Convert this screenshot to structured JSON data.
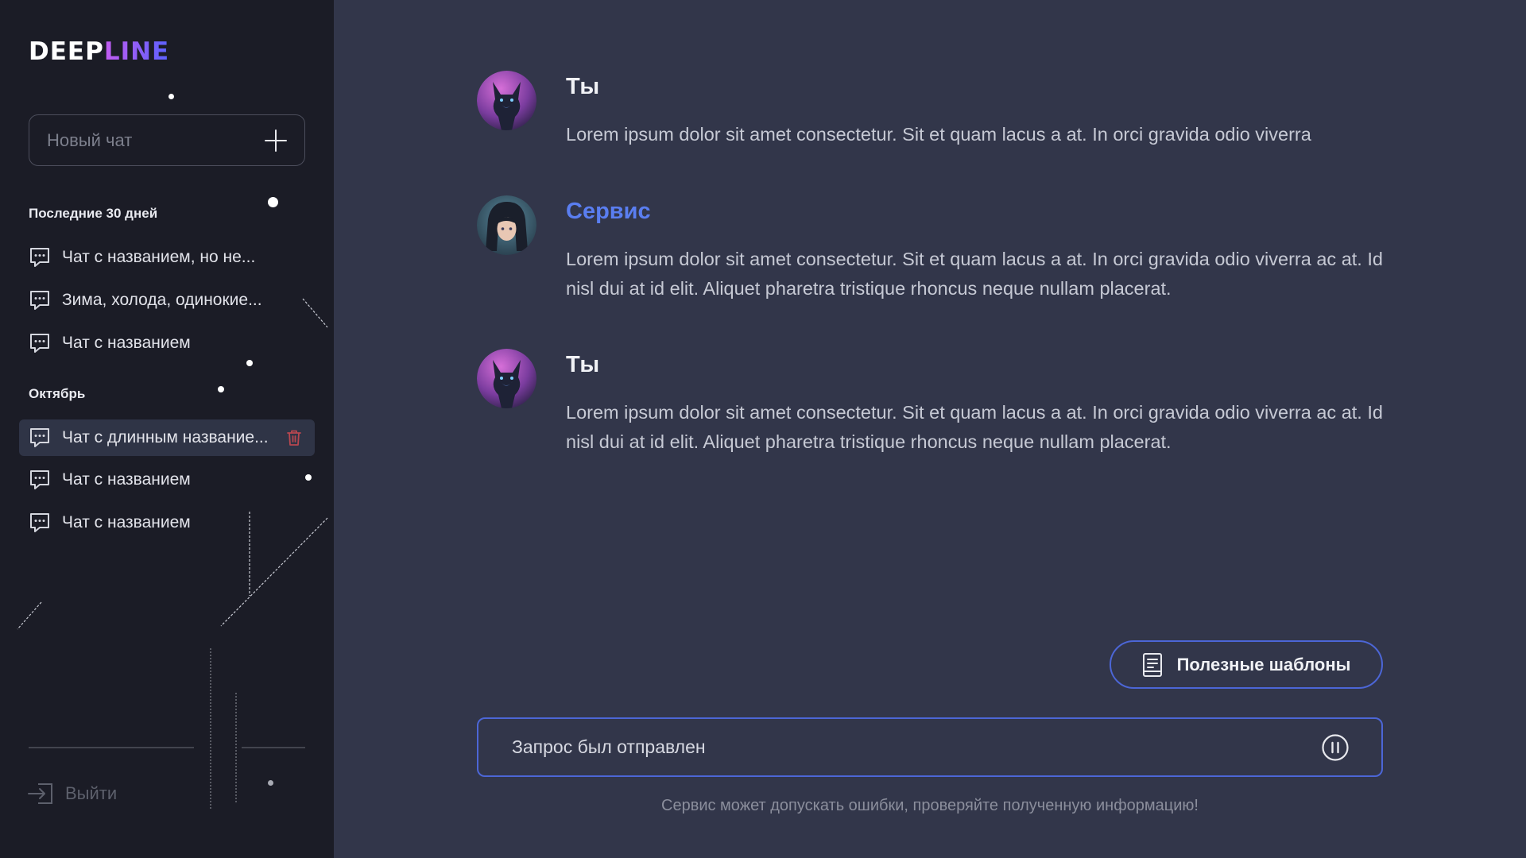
{
  "sidebar": {
    "logo": {
      "part1": "DEEP",
      "part2": "LINE"
    },
    "new_chat": {
      "label": "Новый чат"
    },
    "sections": [
      {
        "title": "Последние 30 дней",
        "items": [
          {
            "label": "Чат с названием, но не..."
          },
          {
            "label": "Зима, холода, одинокие..."
          },
          {
            "label": "Чат с названием"
          }
        ]
      },
      {
        "title": "Октябрь",
        "items": [
          {
            "label": "Чат с длинным название..."
          },
          {
            "label": "Чат с названием"
          },
          {
            "label": "Чат с названием"
          }
        ]
      }
    ],
    "logout": {
      "label": "Выйти"
    }
  },
  "messages": [
    {
      "author": "Ты",
      "text": "Lorem ipsum dolor sit amet consectetur. Sit et quam lacus a at. In orci gravida odio viverra"
    },
    {
      "author": "Сервис",
      "text": "Lorem ipsum dolor sit amet consectetur. Sit et quam lacus a at. In orci gravida odio viverra ac at. Id nisl dui at id elit. Aliquet pharetra tristique rhoncus neque nullam placerat."
    },
    {
      "author": "Ты",
      "text": "Lorem ipsum dolor sit amet consectetur. Sit et quam lacus a at. In orci gravida odio viverra ac at. Id nisl dui at id elit. Aliquet pharetra tristique rhoncus neque nullam placerat."
    }
  ],
  "templates_button": {
    "label": "Полезные шаблоны"
  },
  "query": {
    "value": "Запрос был отправлен"
  },
  "disclaimer": "Сервис может допускать ошибки, проверяйте полученную информацию!",
  "colors": {
    "sidebar_bg": "#1b1c26",
    "main_bg": "#32364a",
    "accent_blue": "#4c66d6",
    "service_name": "#5a7ef0",
    "logo_gradient": [
      "#c35bf0",
      "#5a62ff"
    ],
    "trash": "#b8474f"
  },
  "icons": {
    "new_chat": "plus-icon",
    "chat_item": "chat-bubble-icon",
    "delete": "trash-icon",
    "logout": "logout-icon",
    "templates": "document-icon",
    "query_action": "pause-icon"
  }
}
